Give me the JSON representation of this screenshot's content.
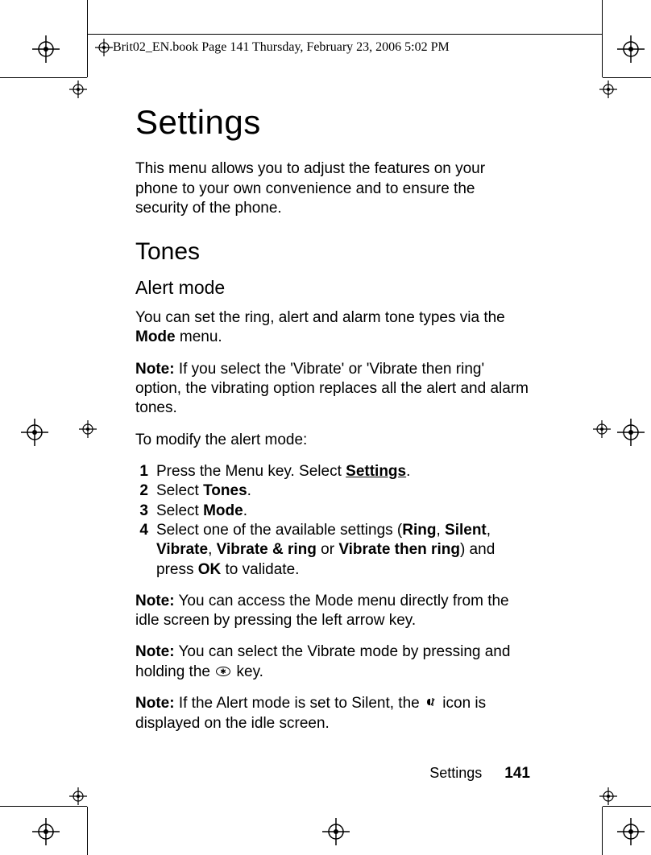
{
  "header": {
    "running_head": "Brit02_EN.book  Page 141  Thursday, February 23, 2006  5:02 PM"
  },
  "title": "Settings",
  "intro": "This menu allows you to adjust the features on your phone to your own convenience and to ensure the security of the phone.",
  "section_tones": "Tones",
  "subsection_alert_mode": "Alert mode",
  "alert_mode_para_pre": "You can set the ring, alert and alarm tone types via the ",
  "alert_mode_para_mode": "Mode",
  "alert_mode_para_post": " menu.",
  "note1_label": "Note:",
  "note1_body": " If you select the 'Vibrate' or 'Vibrate then ring' option, the vibrating option replaces all the alert and alarm tones.",
  "modify_line": "To modify the alert mode:",
  "steps": {
    "s1_a": "Press the Menu key. Select ",
    "s1_b": "Settings",
    "s1_c": ".",
    "s2_a": "Select ",
    "s2_b": "Tones",
    "s2_c": ".",
    "s3_a": "Select ",
    "s3_b": "Mode",
    "s3_c": ".",
    "s4_a": "Select one of the available settings (",
    "s4_ring": "Ring",
    "s4_sep1": ", ",
    "s4_silent": "Silent",
    "s4_sep2": ", ",
    "s4_vibrate": "Vibrate",
    "s4_sep3": ", ",
    "s4_vibring": "Vibrate & ring",
    "s4_or": " or ",
    "s4_vibthen": "Vibrate then ring",
    "s4_b": ") and press ",
    "s4_ok": "OK",
    "s4_c": " to validate."
  },
  "note2_label": "Note:",
  "note2_body": " You can access the Mode menu directly from the idle screen by pressing the left arrow key.",
  "note3_label": "Note:",
  "note3_body_a": " You can select the Vibrate mode by pressing and holding the ",
  "note3_body_b": " key.",
  "note4_label": "Note:",
  "note4_body_a": " If the Alert mode is set to Silent, the ",
  "note4_body_b": " icon is displayed on the idle screen.",
  "footer": {
    "section": "Settings",
    "page": "141"
  },
  "icons": {
    "star_key": "star-key-icon",
    "silent": "silent-mode-icon"
  }
}
